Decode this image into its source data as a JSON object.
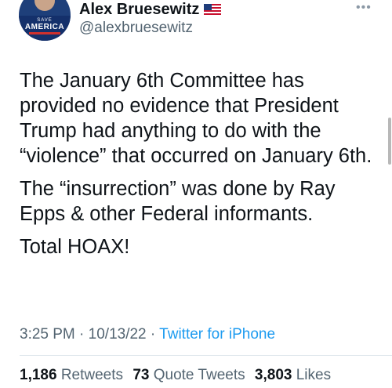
{
  "author": {
    "display_name": "Alex Bruesewitz",
    "handle": "@alexbruesewitz",
    "avatar_text": [
      "SAVE",
      "AMERICA"
    ],
    "flag_icon": "us-flag-icon"
  },
  "tweet": {
    "paragraphs": [
      "The January 6th Committee has provided no evidence that President Trump had anything to do with the “violence” that occurred on January 6th.",
      "The “insurrection” was done by Ray Epps & other Federal informants.",
      "Total HOAX!"
    ],
    "time": "3:25 PM",
    "separator": " · ",
    "date": "10/13/22",
    "source": "Twitter for iPhone"
  },
  "stats": {
    "retweets_count": "1,186",
    "retweets_label": "Retweets",
    "quotes_count": "73",
    "quotes_label": "Quote Tweets",
    "likes_count": "3,803",
    "likes_label": "Likes"
  },
  "colors": {
    "link": "#1d9bf0",
    "secondary_text": "#536471",
    "primary_text": "#0f1419"
  }
}
